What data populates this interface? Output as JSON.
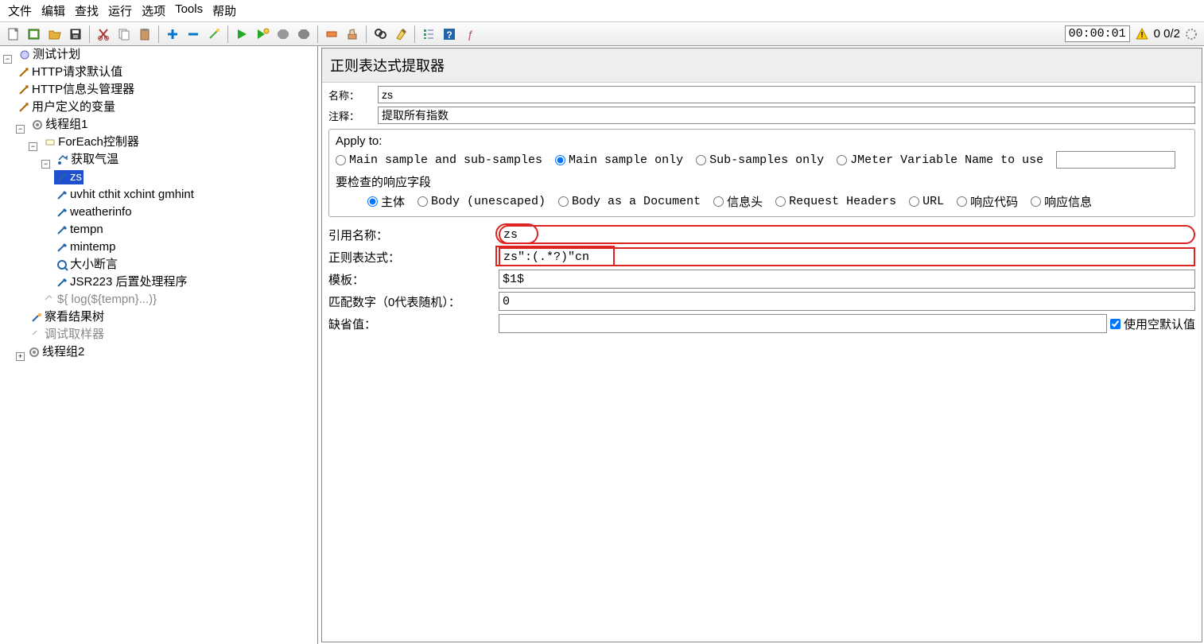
{
  "menu": [
    "文件",
    "编辑",
    "查找",
    "运行",
    "选项",
    "Tools",
    "帮助"
  ],
  "toolbar": {
    "timer": "00:00:01",
    "threads": "0 0/2",
    "icons": [
      "new-file",
      "new-template",
      "open",
      "save",
      "cut",
      "copy",
      "paste",
      "plus",
      "minus",
      "wand",
      "run",
      "run-next",
      "stop",
      "stop-all",
      "clear",
      "clear-all",
      "search",
      "broom",
      "checklist",
      "help",
      "function"
    ]
  },
  "tree": {
    "root": "测试计划",
    "defaults": "HTTP请求默认值",
    "headers": "HTTP信息头管理器",
    "vars": "用户定义的变量",
    "tg1": "线程组1",
    "foreach": "ForEach控制器",
    "sampler": "获取气温",
    "ext": [
      "zs",
      "uvhit cthit xchint gmhint",
      "weatherinfo",
      "tempn",
      "mintemp"
    ],
    "assert": "大小断言",
    "jsr": "JSR223 后置处理程序",
    "log": "${  log(${tempn}...)}",
    "results": "察看结果树",
    "debug": "调试取样器",
    "tg2": "线程组2"
  },
  "panel": {
    "title": "正则表达式提取器",
    "name_label": "名称：",
    "name_value": "zs",
    "comment_label": "注释：",
    "comment_value": "提取所有指数",
    "apply_title": "Apply to:",
    "apply_opts": [
      "Main sample and sub-samples",
      "Main sample only",
      "Sub-samples only",
      "JMeter Variable Name to use"
    ],
    "field_title": "要检查的响应字段",
    "field_opts": [
      "主体",
      "Body (unescaped)",
      "Body as a Document",
      "信息头",
      "Request Headers",
      "URL",
      "响应代码",
      "响应信息"
    ],
    "ref_label": "引用名称：",
    "ref_value": "zs",
    "regex_label": "正则表达式：",
    "regex_value": "zs\":(.*?)\"cn",
    "template_label": "模板：",
    "template_value": "$1$",
    "match_label": "匹配数字（0代表随机）：",
    "match_value": "0",
    "default_label": "缺省值：",
    "default_value": "",
    "use_empty": "使用空默认值"
  }
}
